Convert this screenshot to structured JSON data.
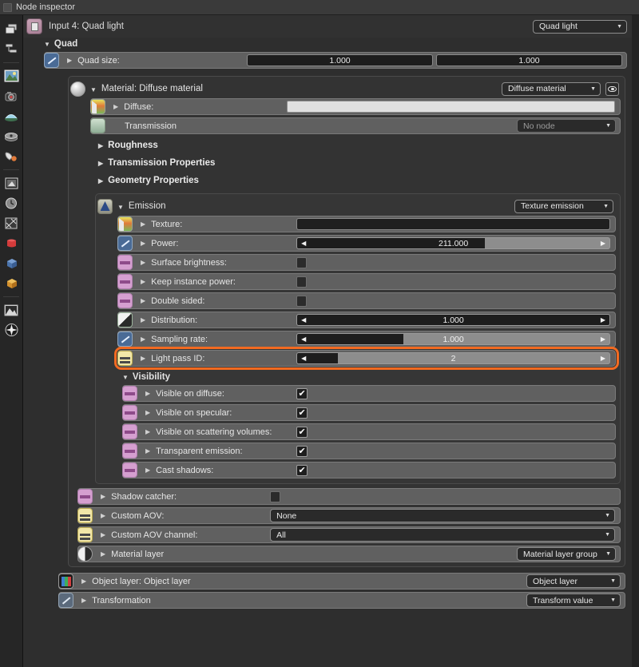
{
  "window": {
    "title": "Node inspector"
  },
  "toolbar": {
    "icons": [
      {
        "name": "layers-icon"
      },
      {
        "name": "nodes-icon"
      },
      {
        "name": "image-icon"
      },
      {
        "name": "camera-icon"
      },
      {
        "name": "environment-icon"
      },
      {
        "name": "film-icon"
      },
      {
        "name": "paint-icon"
      },
      {
        "name": "render-region-icon"
      },
      {
        "name": "clock-icon"
      },
      {
        "name": "network-icon"
      },
      {
        "name": "red-cube-icon"
      },
      {
        "name": "blue-cube-icon"
      },
      {
        "name": "orange-cube-icon"
      },
      {
        "name": "landscape-icon"
      },
      {
        "name": "star-icon"
      }
    ]
  },
  "header": {
    "title": "Input 4: Quad light",
    "type_selector": "Quad light"
  },
  "quad": {
    "group_label": "Quad",
    "quad_size": {
      "label": "Quad size:",
      "x": "1.000",
      "y": "1.000"
    }
  },
  "material": {
    "header_label": "Material: Diffuse material",
    "type_selector": "Diffuse material",
    "diffuse": {
      "label": "Diffuse:",
      "color": "#e0e0e0"
    },
    "transmission": {
      "label": "Transmission",
      "value": "No node"
    },
    "collapsed_sections": [
      "Roughness",
      "Transmission Properties",
      "Geometry Properties"
    ]
  },
  "emission": {
    "header_label": "Emission",
    "type_selector": "Texture emission",
    "rows": [
      {
        "label": "Texture:",
        "kind": "field",
        "icon": "texture-icon"
      },
      {
        "label": "Power:",
        "kind": "slider",
        "value": "211.000",
        "fill_pct": 60,
        "icon": "float-icon"
      },
      {
        "label": "Surface brightness:",
        "kind": "toggle",
        "checked": false,
        "icon": "bool-icon"
      },
      {
        "label": "Keep instance power:",
        "kind": "toggle",
        "checked": false,
        "icon": "bool-icon"
      },
      {
        "label": "Double sided:",
        "kind": "toggle",
        "checked": false,
        "icon": "bool-icon"
      },
      {
        "label": "Distribution:",
        "kind": "slider",
        "value": "1.000",
        "fill_pct": 100,
        "icon": "distribution-icon"
      },
      {
        "label": "Sampling rate:",
        "kind": "slider",
        "value": "1.000",
        "fill_pct": 34,
        "icon": "float-icon"
      },
      {
        "label": "Light pass ID:",
        "kind": "slider",
        "value": "2",
        "fill_pct": 13,
        "icon": "int-icon",
        "highlighted": true
      }
    ],
    "visibility": {
      "group_label": "Visibility",
      "rows": [
        {
          "label": "Visible on diffuse:",
          "checked": true
        },
        {
          "label": "Visible on specular:",
          "checked": true
        },
        {
          "label": "Visible on scattering volumes:",
          "checked": true
        },
        {
          "label": "Transparent emission:",
          "checked": true
        },
        {
          "label": "Cast shadows:",
          "checked": true
        }
      ],
      "check_glyph": "✔"
    }
  },
  "material_footer": {
    "shadow_catcher": {
      "label": "Shadow catcher:",
      "checked": false
    },
    "custom_aov": {
      "label": "Custom AOV:",
      "value": "None"
    },
    "custom_aov_channel": {
      "label": "Custom AOV channel:",
      "value": "All"
    },
    "material_layer": {
      "label": "Material layer",
      "value": "Material layer group"
    }
  },
  "object_layer": {
    "label": "Object layer: Object layer",
    "value": "Object layer"
  },
  "transformation": {
    "label": "Transformation",
    "value": "Transform value"
  },
  "colors": {
    "highlight": "#f26a21",
    "panel": "#2e2e2e",
    "row": "#606060"
  }
}
